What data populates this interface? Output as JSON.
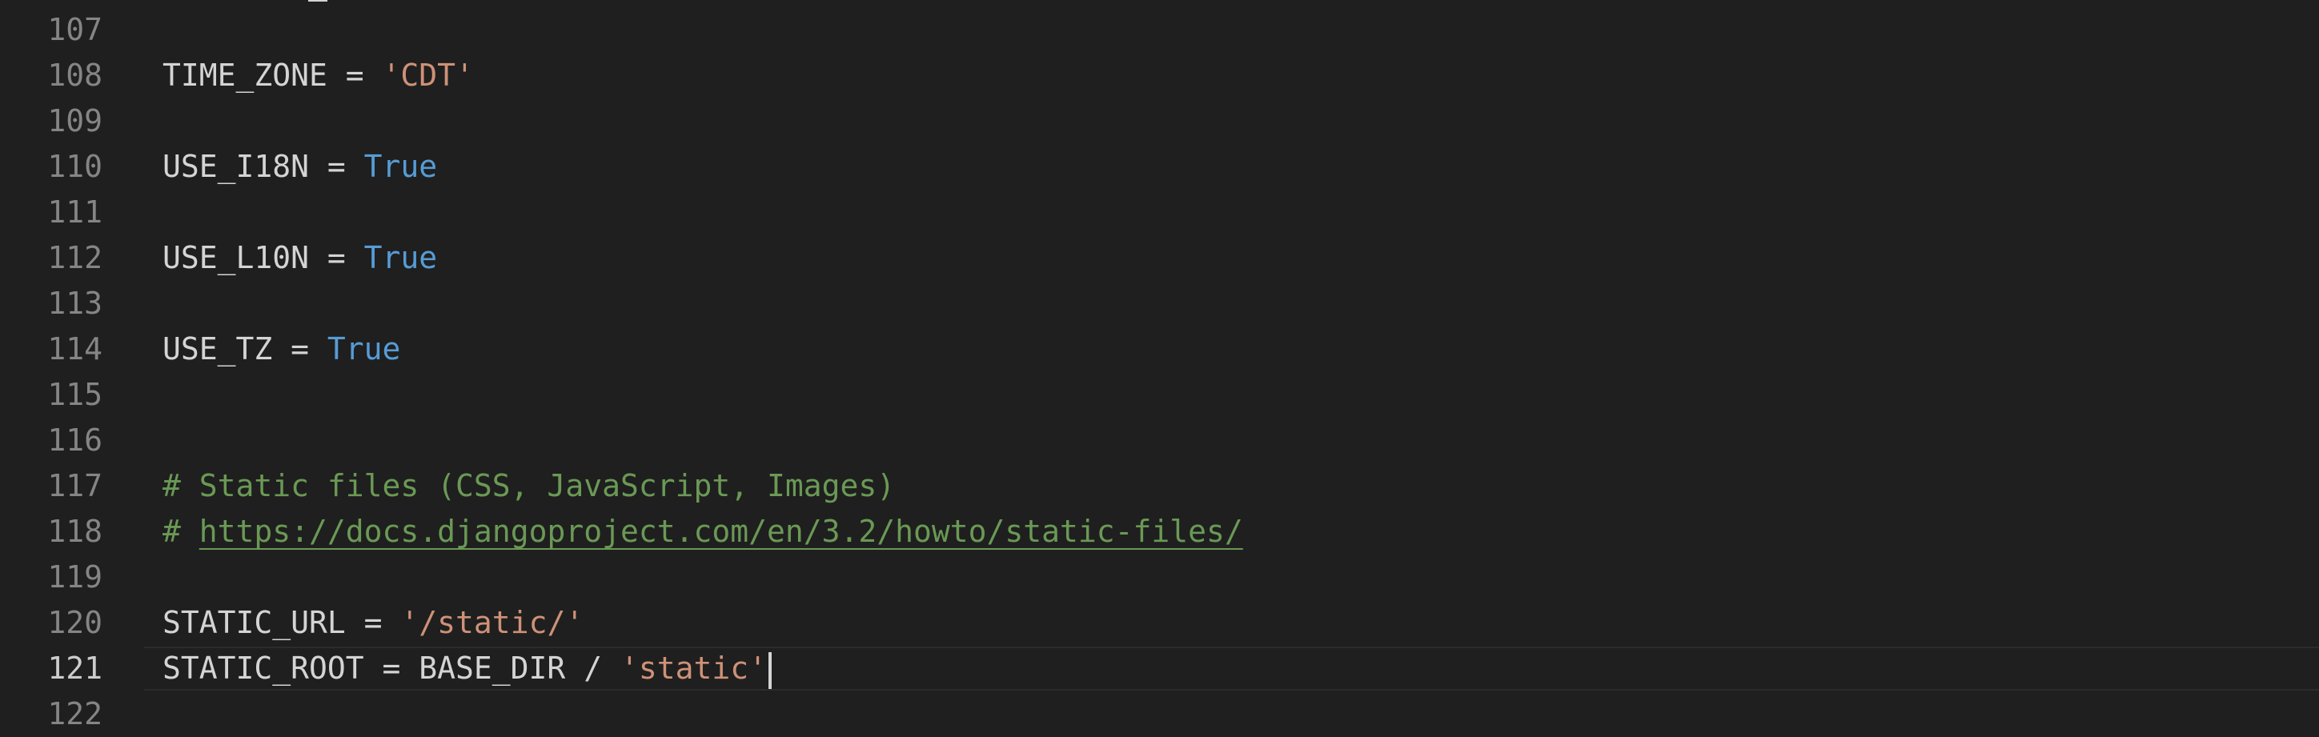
{
  "editor": {
    "lines": [
      {
        "number": "107",
        "parts": []
      },
      {
        "number": "108",
        "parts": [
          {
            "t": "TIME_ZONE = ",
            "c": "plain"
          },
          {
            "t": "'CDT'",
            "c": "str"
          }
        ]
      },
      {
        "number": "109",
        "parts": []
      },
      {
        "number": "110",
        "parts": [
          {
            "t": "USE_I18N = ",
            "c": "plain"
          },
          {
            "t": "True",
            "c": "kw-true"
          }
        ]
      },
      {
        "number": "111",
        "parts": []
      },
      {
        "number": "112",
        "parts": [
          {
            "t": "USE_L10N = ",
            "c": "plain"
          },
          {
            "t": "True",
            "c": "kw-true"
          }
        ]
      },
      {
        "number": "113",
        "parts": []
      },
      {
        "number": "114",
        "parts": [
          {
            "t": "USE_TZ = ",
            "c": "plain"
          },
          {
            "t": "True",
            "c": "kw-true"
          }
        ]
      },
      {
        "number": "115",
        "parts": []
      },
      {
        "number": "116",
        "parts": []
      },
      {
        "number": "117",
        "parts": [
          {
            "t": "# Static files (CSS, JavaScript, Images)",
            "c": "comment"
          }
        ]
      },
      {
        "number": "118",
        "parts": [
          {
            "t": "# ",
            "c": "comment"
          },
          {
            "t": "https://docs.djangoproject.com/en/3.2/howto/static-files/",
            "c": "link"
          }
        ]
      },
      {
        "number": "119",
        "parts": []
      },
      {
        "number": "120",
        "parts": [
          {
            "t": "STATIC_URL = ",
            "c": "plain"
          },
          {
            "t": "'/static/'",
            "c": "str"
          }
        ]
      },
      {
        "number": "121",
        "parts": [
          {
            "t": "STATIC_ROOT = BASE_DIR / ",
            "c": "plain"
          },
          {
            "t": "'static'",
            "c": "str"
          }
        ],
        "current": true
      },
      {
        "number": "122",
        "parts": []
      }
    ]
  },
  "colors": {
    "background": "#1f1f1f",
    "plain_text": "#d4d4d4",
    "string": "#ce9178",
    "keyword_true": "#569cd6",
    "comment": "#6a9955",
    "line_number": "#858585",
    "current_line_number": "#cccccc"
  }
}
